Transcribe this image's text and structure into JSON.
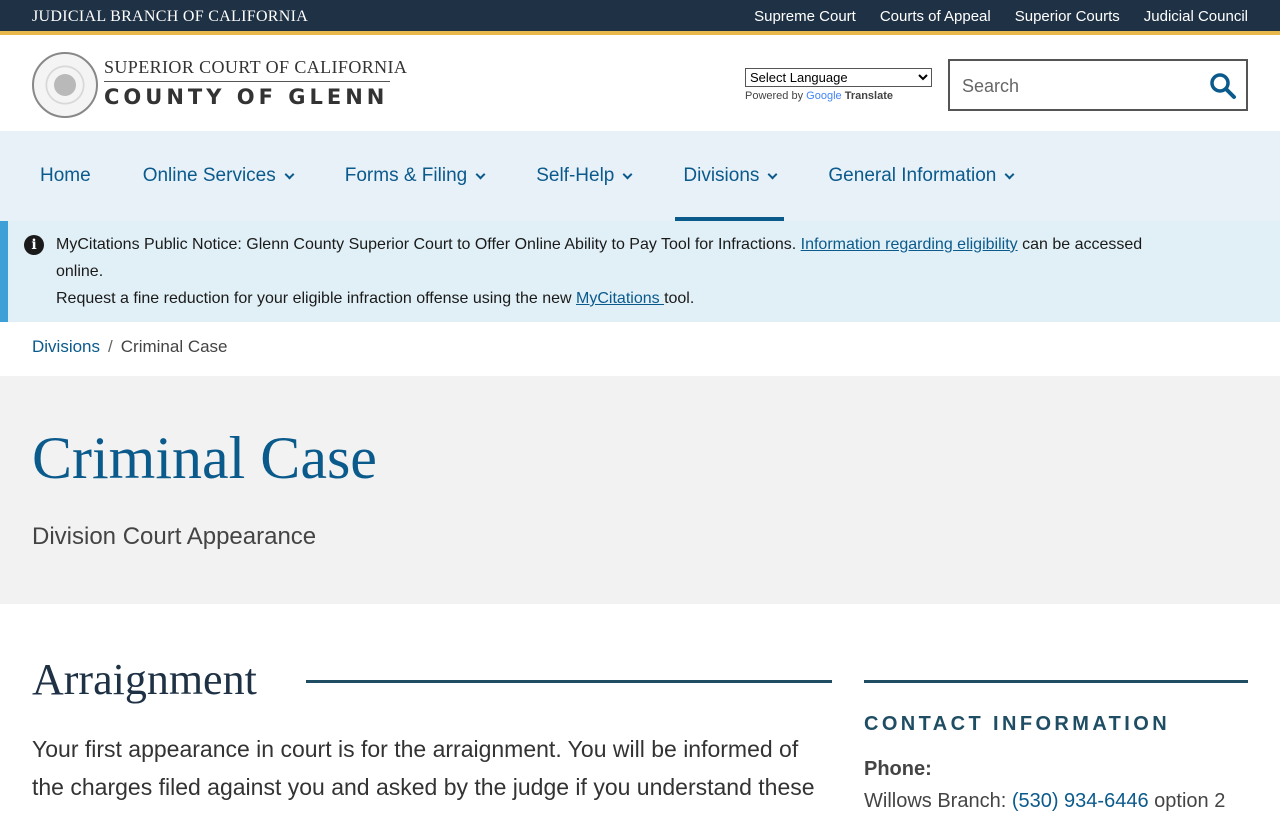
{
  "topbar": {
    "branch": "JUDICIAL BRANCH OF CALIFORNIA",
    "links": [
      "Supreme Court",
      "Courts of Appeal",
      "Superior Courts",
      "Judicial Council"
    ]
  },
  "header": {
    "court_line1": "SUPERIOR COURT OF CALIFORNIA",
    "court_line2": "COUNTY OF GLENN",
    "translate_select": "Select Language",
    "powered_by": "Powered by",
    "google": "Google",
    "translate": "Translate",
    "search_placeholder": "Search"
  },
  "nav": {
    "items": [
      {
        "label": "Home",
        "dropdown": false
      },
      {
        "label": "Online Services",
        "dropdown": true
      },
      {
        "label": "Forms & Filing",
        "dropdown": true
      },
      {
        "label": "Self-Help",
        "dropdown": true
      },
      {
        "label": "Divisions",
        "dropdown": true,
        "active": true
      },
      {
        "label": "General Information",
        "dropdown": true
      }
    ]
  },
  "notice": {
    "part1": "MyCitations Public Notice: Glenn County Superior Court to Offer Online Ability to Pay Tool for Infractions. ",
    "link1": "Information regarding eligibility",
    "part2": " can be accessed online.",
    "part3": "Request a fine reduction for your eligible infraction offense using the new ",
    "link2": "MyCitations ",
    "part4": "tool."
  },
  "breadcrumb": {
    "parent": "Divisions",
    "separator": "/",
    "current": "Criminal Case"
  },
  "hero": {
    "title": "Criminal Case",
    "subtitle": "Division Court Appearance"
  },
  "main": {
    "heading": "Arraignment",
    "paragraph": "Your first appearance in court is for the arraignment. You will be informed of the charges filed against you and asked by the judge if you understand these"
  },
  "sidebar": {
    "title": "CONTACT INFORMATION",
    "phone_label": "Phone:",
    "phone_prefix": "Willows Branch: ",
    "phone_number": "(530) 934-6446",
    "phone_suffix": " option 2"
  },
  "colors": {
    "topbar_bg": "#1f3144",
    "accent_gold": "#e8b84a",
    "link_blue": "#0b5a8c",
    "nav_bg": "#e8f1f8",
    "notice_bg": "#e1f0f7",
    "hero_bg": "#f2f2f2"
  }
}
